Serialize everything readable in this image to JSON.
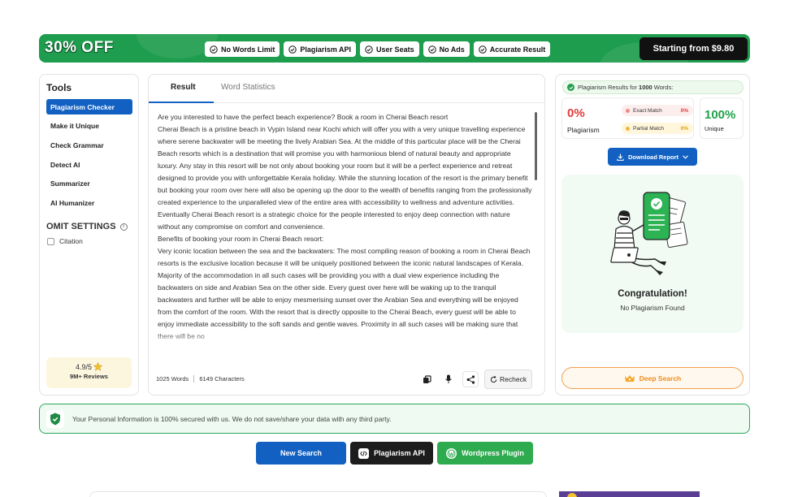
{
  "promo": {
    "discount": "30% OFF",
    "features": [
      "No Words Limit",
      "Plagiarism API",
      "User Seats",
      "No Ads",
      "Accurate Result"
    ],
    "cta": "Starting from $9.80"
  },
  "tools": {
    "title": "Tools",
    "items": [
      "Plagiarism Checker",
      "Make it Unique",
      "Check Grammar",
      "Detect AI",
      "Summarizer",
      "AI Humanizer"
    ],
    "active_index": 0,
    "omit_title": "OMIT SETTINGS",
    "citation_label": "Citation",
    "rating_score": "4.9/5",
    "rating_reviews": "9M+ Reviews"
  },
  "editor": {
    "tabs": [
      "Result",
      "Word Statistics"
    ],
    "paragraphs": [
      "Are you interested to have the perfect beach experience? Book a room in Cherai Beach resort",
      "Cherai Beach is a pristine beach in Vypin Island near Kochi which will offer you with a very unique travelling experience where serene backwater will be meeting the lively Arabian Sea. At the middle of this particular place will be the Cherai Beach resorts which is a destination that will promise you with harmonious blend of natural beauty and appropriate luxury. Any stay in this resort will be not only about booking your room but it will be a perfect experience and retreat designed to provide you with unforgettable Kerala holiday. While the stunning location of the resort is the primary benefit but booking your room over here will also be opening up the door to the wealth of benefits ranging from the professionally created experience to the unparalleled view of the entire area with accessibility to wellness and adventure activities. Eventually Cherai Beach resort is a strategic choice for the people interested to enjoy deep connection with nature without any compromise on comfort and convenience.",
      "Benefits of booking your room in Cherai Beach resort:",
      "Very iconic location between the sea and the backwaters: The most compiling reason of booking a room in Cherai Beach resorts is the exclusive location because it will be uniquely positioned between the iconic natural landscapes of Kerala. Majority of the accommodation in all such cases will be providing you with a dual view experience including the backwaters on side and Arabian Sea on the other side. Every guest over here will be waking up to the tranquil backwaters and further will be able to enjoy mesmerising sunset over the Arabian Sea and everything will be enjoyed from the comfort of the room. With the resort that is directly opposite to the Cherai Beach, every guest will be able to enjoy immediate accessibility to the soft sands and gentle waves. Proximity in all such cases will be making sure that there will be no"
    ],
    "word_count": "1025 Words",
    "char_count": "6149 Characters",
    "recheck_label": "Recheck"
  },
  "results": {
    "header_prefix": "Plagiarism Results for ",
    "header_words": "1000",
    "header_suffix": " Words:",
    "plagiarism_pct": "0%",
    "plagiarism_label": "Plagiarism",
    "exact_label": "Exact Match",
    "exact_value": "0%",
    "partial_label": "Partial Match",
    "partial_value": "0%",
    "unique_pct": "100%",
    "unique_label": "Unique",
    "download_label": "Download Report",
    "congrats_title": "Congratulation!",
    "congrats_sub": "No Plagiarism Found",
    "deep_search_label": "Deep Search"
  },
  "privacy": {
    "text": "Your Personal Information is 100% secured with us. We do not save/share your data with any third party."
  },
  "buttons": {
    "new_search": "New Search",
    "plagiarism_api": "Plagiarism API",
    "wordpress_plugin": "Wordpress Plugin"
  },
  "colors": {
    "brand_green": "#1f9d4e",
    "brand_blue": "#1261c2",
    "danger_red": "#e23b3b",
    "warning_orange": "#f08b1c"
  }
}
